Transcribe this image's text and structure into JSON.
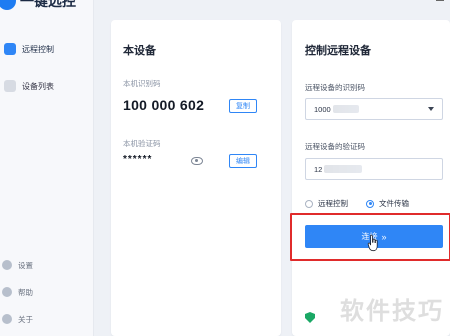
{
  "app": {
    "brand_name": "一键远控"
  },
  "sidebar": {
    "items": [
      {
        "label": "远程控制",
        "icon": "cloud-icon",
        "active": true
      },
      {
        "label": "设备列表",
        "icon": "device-icon",
        "active": false
      }
    ],
    "bottom_items": [
      {
        "label": "设置",
        "icon": "settings-icon"
      },
      {
        "label": "帮助",
        "icon": "help-icon"
      },
      {
        "label": "关于",
        "icon": "info-icon"
      }
    ]
  },
  "this_device": {
    "title": "本设备",
    "id_label": "本机识别码",
    "id_value": "100 000 602",
    "copy_button": "复制",
    "code_label": "本机验证码",
    "code_mask": "******",
    "edit_button": "编辑"
  },
  "remote_control": {
    "title": "控制远程设备",
    "device_id_label": "远程设备的识别码",
    "device_id_value": "1000",
    "device_code_label": "远程设备的验证码",
    "device_code_value": "12",
    "mode_options": [
      {
        "label": "远程控制",
        "selected": false
      },
      {
        "label": "文件传输",
        "selected": true
      }
    ],
    "connect_button": "连接",
    "connect_chevron": "»"
  },
  "watermark": {
    "text": "软件技巧"
  },
  "colors": {
    "accent": "#2f86f6",
    "highlight_border": "#e02b2b",
    "shield_green": "#1aa865"
  }
}
